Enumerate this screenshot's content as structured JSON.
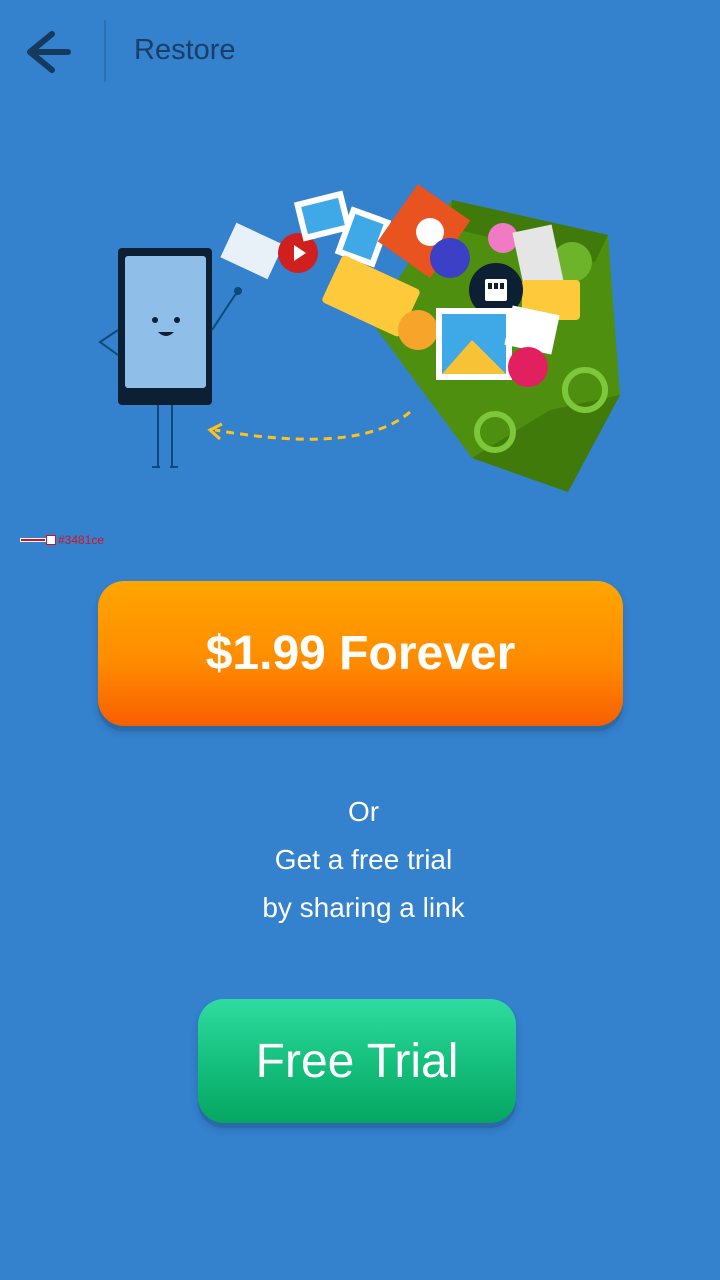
{
  "header": {
    "title": "Restore"
  },
  "debug": {
    "label": "#3481ce"
  },
  "buy_button": {
    "label": "$1.99 Forever"
  },
  "share_text": {
    "line1": "Or",
    "line2": "Get a free trial",
    "line3": "by sharing a link"
  },
  "trial_button": {
    "label": "Free Trial"
  },
  "colors": {
    "background": "#3481ce",
    "buy_orange": "#ff8c00",
    "trial_green": "#16c07e",
    "header_text": "#1a3f66"
  }
}
